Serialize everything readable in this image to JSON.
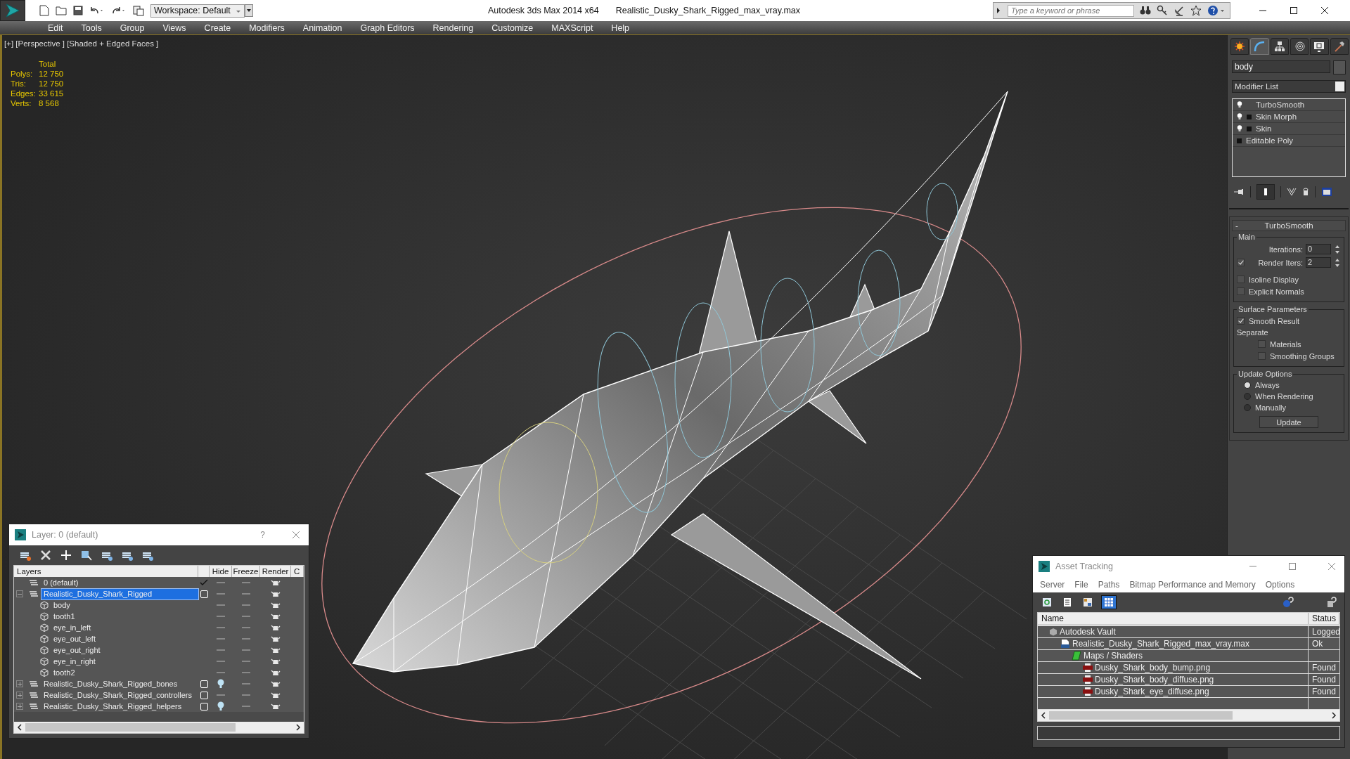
{
  "title_bar": {
    "workspace": "Workspace: Default",
    "app_title": "Autodesk 3ds Max  2014 x64",
    "file_name": "Realistic_Dusky_Shark_Rigged_max_vray.max",
    "search": {
      "placeholder": "Type a keyword or phrase"
    }
  },
  "menu": [
    "Edit",
    "Tools",
    "Group",
    "Views",
    "Create",
    "Modifiers",
    "Animation",
    "Graph Editors",
    "Rendering",
    "Customize",
    "MAXScript",
    "Help"
  ],
  "viewport": {
    "label": "[+] [Perspective ] [Shaded + Edged Faces ]",
    "stats_header": "Total",
    "stats": [
      {
        "label": "Polys:",
        "value": "12 750"
      },
      {
        "label": "Tris:",
        "value": "12 750"
      },
      {
        "label": "Edges:",
        "value": "33 615"
      },
      {
        "label": "Verts:",
        "value": "8 568"
      }
    ]
  },
  "command_panel": {
    "tabs": [
      {
        "kind": "create",
        "selected": false
      },
      {
        "kind": "modify",
        "selected": true
      },
      {
        "kind": "hierarchy",
        "selected": false
      },
      {
        "kind": "motion",
        "selected": false
      },
      {
        "kind": "display",
        "selected": false
      },
      {
        "kind": "utilities",
        "selected": false
      }
    ],
    "object_name": "body",
    "modifier_list": "Modifier List",
    "stack": [
      {
        "label": "TurboSmooth",
        "bulb": true,
        "expandable": false
      },
      {
        "label": "Skin Morph",
        "bulb": true,
        "expandable": true
      },
      {
        "label": "Skin",
        "bulb": true,
        "expandable": true
      },
      {
        "label": "Editable Poly",
        "bulb": false,
        "expandable": true
      }
    ],
    "rollout": {
      "collapse": "-",
      "title": "TurboSmooth",
      "main": {
        "title": "Main",
        "iterations": {
          "label": "Iterations:",
          "value": "0"
        },
        "render_iters": {
          "label": "Render Iters:",
          "value": "2",
          "checked": true
        },
        "options": [
          {
            "label": "Isoline Display",
            "checked": false
          },
          {
            "label": "Explicit Normals",
            "checked": false
          }
        ]
      },
      "surface": {
        "title": "Surface Parameters",
        "smooth_result": {
          "label": "Smooth Result",
          "checked": true
        },
        "separate": "Separate",
        "separate_options": [
          {
            "label": "Materials",
            "checked": false
          },
          {
            "label": "Smoothing Groups",
            "checked": false
          }
        ]
      },
      "update": {
        "title": "Update Options",
        "modes": [
          {
            "label": "Always",
            "selected": true
          },
          {
            "label": "When Rendering",
            "selected": false
          },
          {
            "label": "Manually",
            "selected": false
          }
        ],
        "button": "Update"
      }
    }
  },
  "layer_window": {
    "title": "Layer: 0 (default)",
    "help": "?",
    "columns": [
      "Layers",
      "Hide",
      "Freeze",
      "Render",
      "C"
    ],
    "layers": [
      {
        "name": "0 (default)",
        "kind": "layer",
        "selected": false,
        "current": true,
        "hidden": false
      },
      {
        "name": "Realistic_Dusky_Shark_Rigged",
        "kind": "layer",
        "selected": true,
        "expanded": true,
        "current": false,
        "hidden": false,
        "children": [
          {
            "name": "body",
            "kind": "object",
            "selected": false,
            "hidden": false
          },
          {
            "name": "tooth1",
            "kind": "object",
            "selected": false,
            "hidden": false
          },
          {
            "name": "eye_in_left",
            "kind": "object",
            "selected": false,
            "hidden": false
          },
          {
            "name": "eye_out_left",
            "kind": "object",
            "selected": false,
            "hidden": false
          },
          {
            "name": "eye_out_right",
            "kind": "object",
            "selected": false,
            "hidden": false
          },
          {
            "name": "eye_in_right",
            "kind": "object",
            "selected": false,
            "hidden": false
          },
          {
            "name": "tooth2",
            "kind": "object",
            "selected": false,
            "hidden": false
          }
        ]
      },
      {
        "name": "Realistic_Dusky_Shark_Rigged_bones",
        "kind": "layer",
        "selected": false,
        "expanded": false,
        "current": false,
        "hidden": true
      },
      {
        "name": "Realistic_Dusky_Shark_Rigged_controllers",
        "kind": "layer",
        "selected": false,
        "expanded": false,
        "current": false,
        "hidden": false
      },
      {
        "name": "Realistic_Dusky_Shark_Rigged_helpers",
        "kind": "layer",
        "selected": false,
        "expanded": false,
        "current": false,
        "hidden": true
      }
    ]
  },
  "asset_window": {
    "title": "Asset Tracking",
    "menu": [
      "Server",
      "File",
      "Paths",
      "Bitmap Performance and Memory",
      "Options"
    ],
    "toolbar": [
      {
        "kind": "refresh",
        "selected": false
      },
      {
        "kind": "list",
        "selected": false
      },
      {
        "kind": "thumbnails",
        "selected": false
      },
      {
        "kind": "table",
        "selected": true
      }
    ],
    "columns": [
      "Name",
      "Status"
    ],
    "rows": [
      {
        "name": "Autodesk Vault",
        "kind": "vault",
        "status": "Logged",
        "children": [
          {
            "name": "Realistic_Dusky_Shark_Rigged_max_vray.max",
            "kind": "max",
            "status": "Ok",
            "children": [
              {
                "name": "Maps / Shaders",
                "kind": "maps",
                "children": [
                  {
                    "name": "Dusky_Shark_body_bump.png",
                    "kind": "png",
                    "status": "Found"
                  },
                  {
                    "name": "Dusky_Shark_body_diffuse.png",
                    "kind": "png",
                    "status": "Found"
                  },
                  {
                    "name": "Dusky_Shark_eye_diffuse.png",
                    "kind": "png",
                    "status": "Found"
                  }
                ]
              }
            ]
          }
        ]
      }
    ]
  }
}
